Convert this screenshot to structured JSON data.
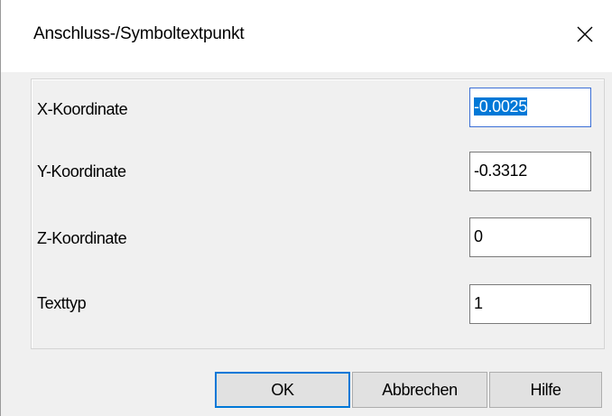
{
  "window": {
    "title": "Anschluss-/Symboltextpunkt"
  },
  "fields": [
    {
      "label": "X-Koordinate",
      "value": "-0.0025",
      "selected": true
    },
    {
      "label": "Y-Koordinate",
      "value": "-0.3312"
    },
    {
      "label": "Z-Koordinate",
      "value": "0"
    },
    {
      "label": "Texttyp",
      "value": "1"
    }
  ],
  "buttons": {
    "ok": "OK",
    "cancel": "Abbrechen",
    "help": "Hilfe"
  },
  "colors": {
    "selection": "#0078d7",
    "focus_border": "#3c6fd6",
    "dialog_bg": "#f0f0f0"
  },
  "icons": {
    "close": "close-icon"
  }
}
